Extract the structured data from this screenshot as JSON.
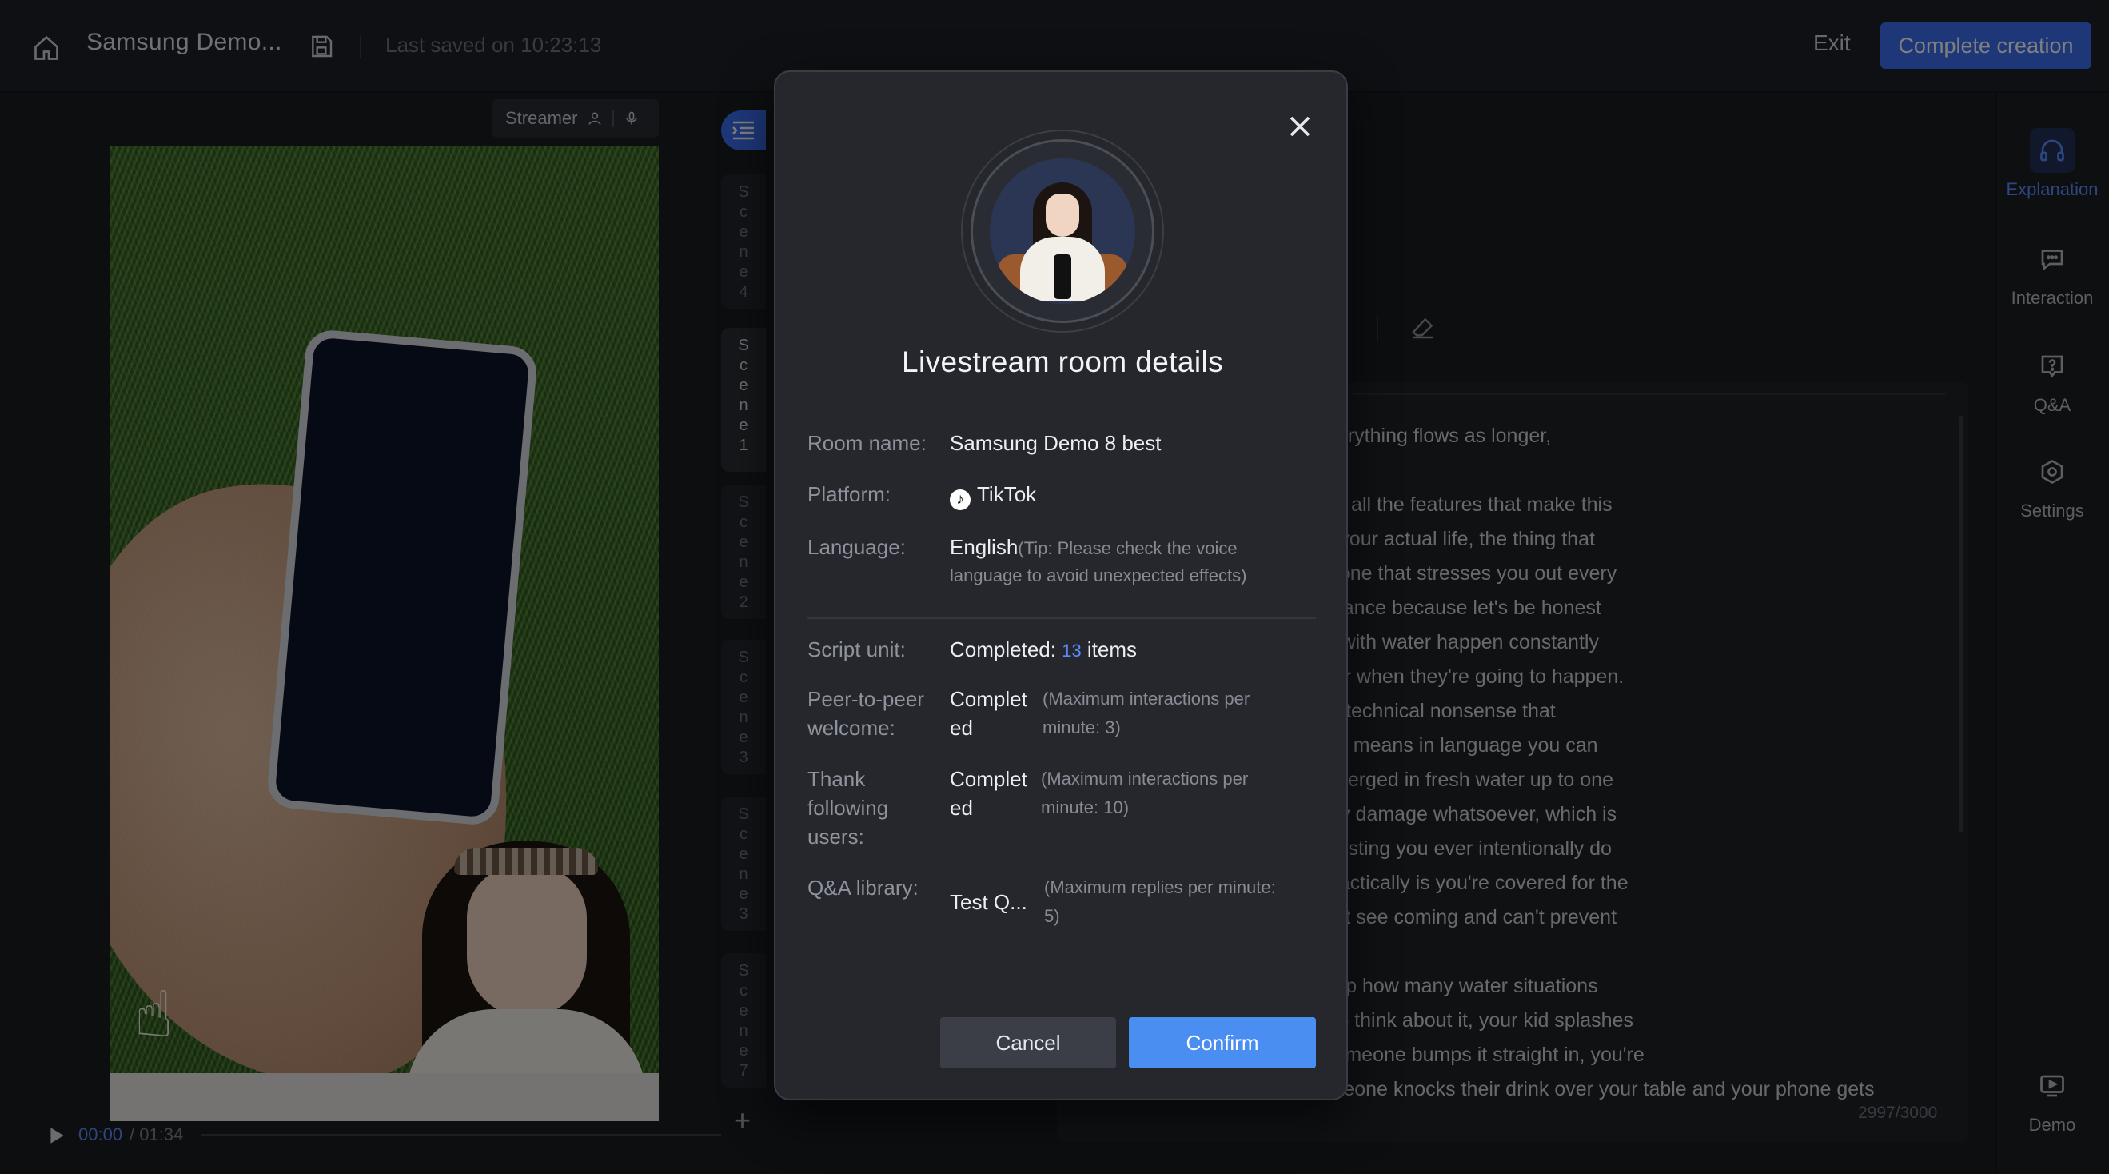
{
  "topbar": {
    "title": "Samsung Demo...",
    "saved_text": "Last saved on 10:23:13",
    "exit_label": "Exit",
    "complete_label": "Complete creation"
  },
  "preview": {
    "streamer_label": "Streamer",
    "time_current": "00:00",
    "time_total": "/ 01:34"
  },
  "scenes": [
    {
      "label": "Scene4",
      "active": false
    },
    {
      "label": "Scene1",
      "active": true
    },
    {
      "label": "Scene2",
      "active": false
    },
    {
      "label": "Scene3",
      "active": false
    },
    {
      "label": "Scene3",
      "active": false
    },
    {
      "label": "Scene7",
      "active": false
    }
  ],
  "editor": {
    "text_lines": [
      "with no short sentences — everything flows as longer,",
      "",
      "the camera, the AI, the design, all the features that make this",
      "t here's what really matters in your actual life, the thing that",
      "enuinely depend on from a phone that stresses you out every",
      "ty, and specifically water resistance because let's be honest",
      "ctually use phones, accidents with water happen constantly",
      "have absolutely no control over when they're going to happen.",
      ", which sounds like the kind of technical nonsense that",
      "mal people, but what it actually means in language you can",
      "survive being completely submerged in fresh water up to one",
      "rty minutes straight without any damage whatsoever, which is",
      "half an hour, and I'm not suggesting you ever intentionally do",
      "diculous, but what it means practically is you're covered for the",
      "n in real life, the ones you don't see coming and can't prevent",
      ".",
      "a second and honestly count up how many water situations",
      "erywhere if you actually stop to think about it, your kid splashes",
      "he's sitting on the edge and someone bumps it straight in, you're",
      "at a bar or restaurant and someone knocks their drink over your table and your phone gets"
    ],
    "char_count": "2997/3000"
  },
  "right_nav": [
    {
      "label": "Explanation",
      "icon": "headphones-icon",
      "active": true
    },
    {
      "label": "Interaction",
      "icon": "chat-icon",
      "active": false
    },
    {
      "label": "Q&A",
      "icon": "question-icon",
      "active": false
    },
    {
      "label": "Settings",
      "icon": "gear-icon",
      "active": false
    },
    {
      "label": "Demo",
      "icon": "play-screen-icon",
      "active": false
    }
  ],
  "modal": {
    "title": "Livestream room details",
    "room_name_label": "Room name:",
    "room_name_value": "Samsung Demo 8 best",
    "platform_label": "Platform:",
    "platform_value": "TikTok",
    "language_label": "Language:",
    "language_value": "English",
    "language_tip_1": "(Tip: Please check the voice",
    "language_tip_2": "language to avoid unexpected effects)",
    "script_label": "Script unit:",
    "script_value_pre": "Completed:",
    "script_count": "13",
    "script_value_post": "items",
    "peer_label_1": "Peer-to-peer",
    "peer_label_2": "welcome:",
    "peer_value_1": "Complet",
    "peer_value_2": "ed",
    "peer_tip_1": "(Maximum interactions per",
    "peer_tip_2": "minute: 3)",
    "thank_label_1": "Thank",
    "thank_label_2": "following",
    "thank_label_3": "users:",
    "thank_value_1": "Complet",
    "thank_value_2": "ed",
    "thank_tip_1": "(Maximum interactions per",
    "thank_tip_2": "minute: 10)",
    "qa_label": "Q&A library:",
    "qa_value": "Test Q...",
    "qa_tip_1": "(Maximum replies per minute:",
    "qa_tip_2": "5)",
    "cancel_label": "Cancel",
    "confirm_label": "Confirm"
  }
}
